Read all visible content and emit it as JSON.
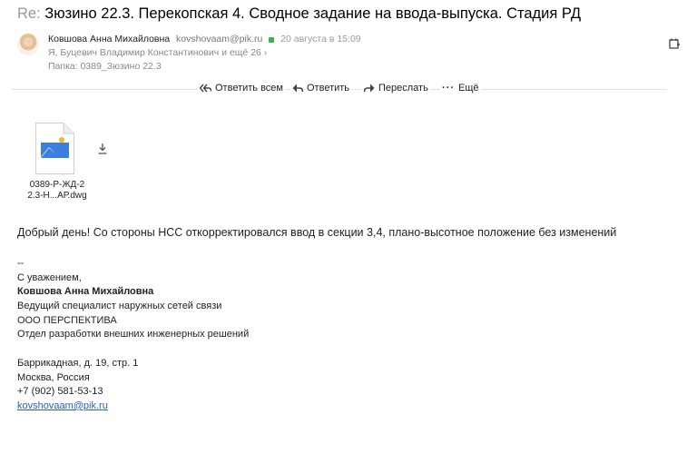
{
  "subject": {
    "prefix": "Re:",
    "text": "Зюзино 22.3. Перекопская 4. Сводное задание на ввода-выпуска. Стадия РД"
  },
  "sender": {
    "name": "Ковшова Анна Михайловна",
    "email": "kovshovaam@pik.ru",
    "date": "20 августа в 15:09",
    "recipients": "Я, Буцевич Владимир Константинович и ещё 26",
    "folder": "Папка:  0389_Зюзино 22.3"
  },
  "toolbar": {
    "reply_all": "Ответить всем",
    "reply": "Ответить",
    "forward": "Переслать",
    "more": "Ещё"
  },
  "attachment": {
    "name_line1": "0389-Р-ЖД-2",
    "name_line2": "2.3-Н...АР.dwg"
  },
  "body": "Добрый день! Со стороны НСС откорректировался ввод в секции 3,4, плано-высотное положение без изменений",
  "signature": {
    "separator": "--",
    "greeting": "С уважением,",
    "name": "Ковшова Анна Михайловна",
    "position": "Ведущий специалист наружных сетей связи",
    "company": "ООО ПЕРСПЕКТИВА",
    "department": "Отдел разработки внешних инженерных решений",
    "address": "Баррикадная, д. 19, стр. 1",
    "city": "Москва, Россия",
    "phone": "+7 (902) 581-53-13",
    "email": "kovshovaam@pik.ru"
  },
  "colors": {
    "link": "#2a5fbf",
    "secure": "#3db44a",
    "file_blue": "#3d7fe0"
  }
}
